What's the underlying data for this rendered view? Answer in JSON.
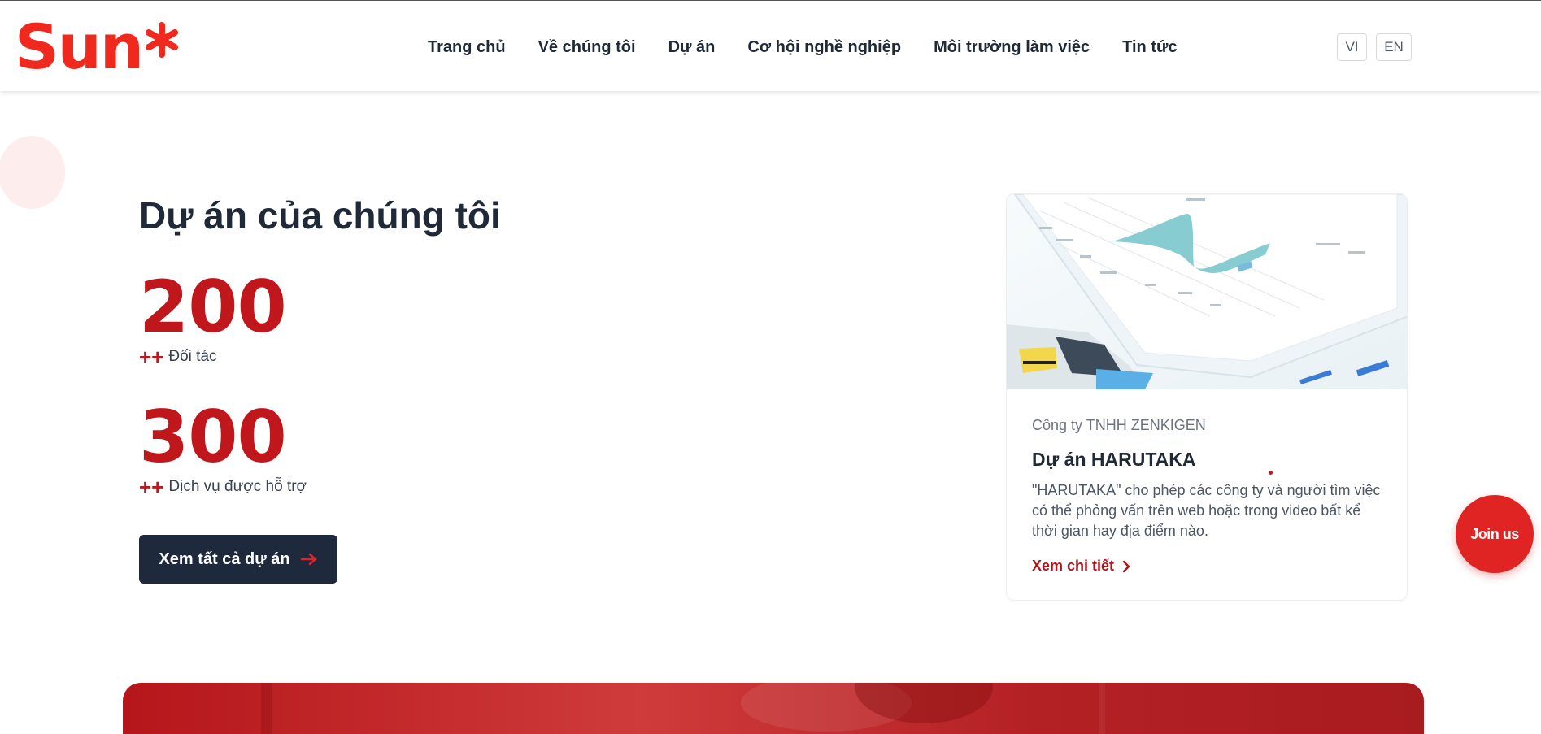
{
  "header": {
    "logo_text": "Sun",
    "nav": [
      "Trang chủ",
      "Về chúng tôi",
      "Dự án",
      "Cơ hội nghề nghiệp",
      "Môi trường làm việc",
      "Tin tức"
    ],
    "lang_vi": "VI",
    "lang_en": "EN"
  },
  "projects": {
    "title": "Dự án của chúng tôi",
    "stats": [
      {
        "number": "200",
        "prefix": "++",
        "label": "Đối tác"
      },
      {
        "number": "300",
        "prefix": "++",
        "label": "Dịch vụ được hỗ trợ"
      }
    ],
    "cta_label": "Xem tất cả dự án"
  },
  "card": {
    "company": "Công ty TNHH ZENKIGEN",
    "title": "Dự án HARUTAKA",
    "description": "\"HARUTAKA\" cho phép các công ty và người tìm việc có thể phỏng vấn trên web hoặc trong video bất kể thời gian hay địa điểm nào.",
    "link_label": "Xem chi tiết"
  },
  "join_label": "Join us",
  "colors": {
    "brand_red": "#f0291e",
    "stat_red": "#c0171c",
    "dark_navy": "#1e293b",
    "join_red": "#e02424"
  },
  "icons": {
    "logo_star": "asterisk-icon",
    "cta_arrow": "arrow-right-icon",
    "card_link": "chevron-right-icon"
  }
}
